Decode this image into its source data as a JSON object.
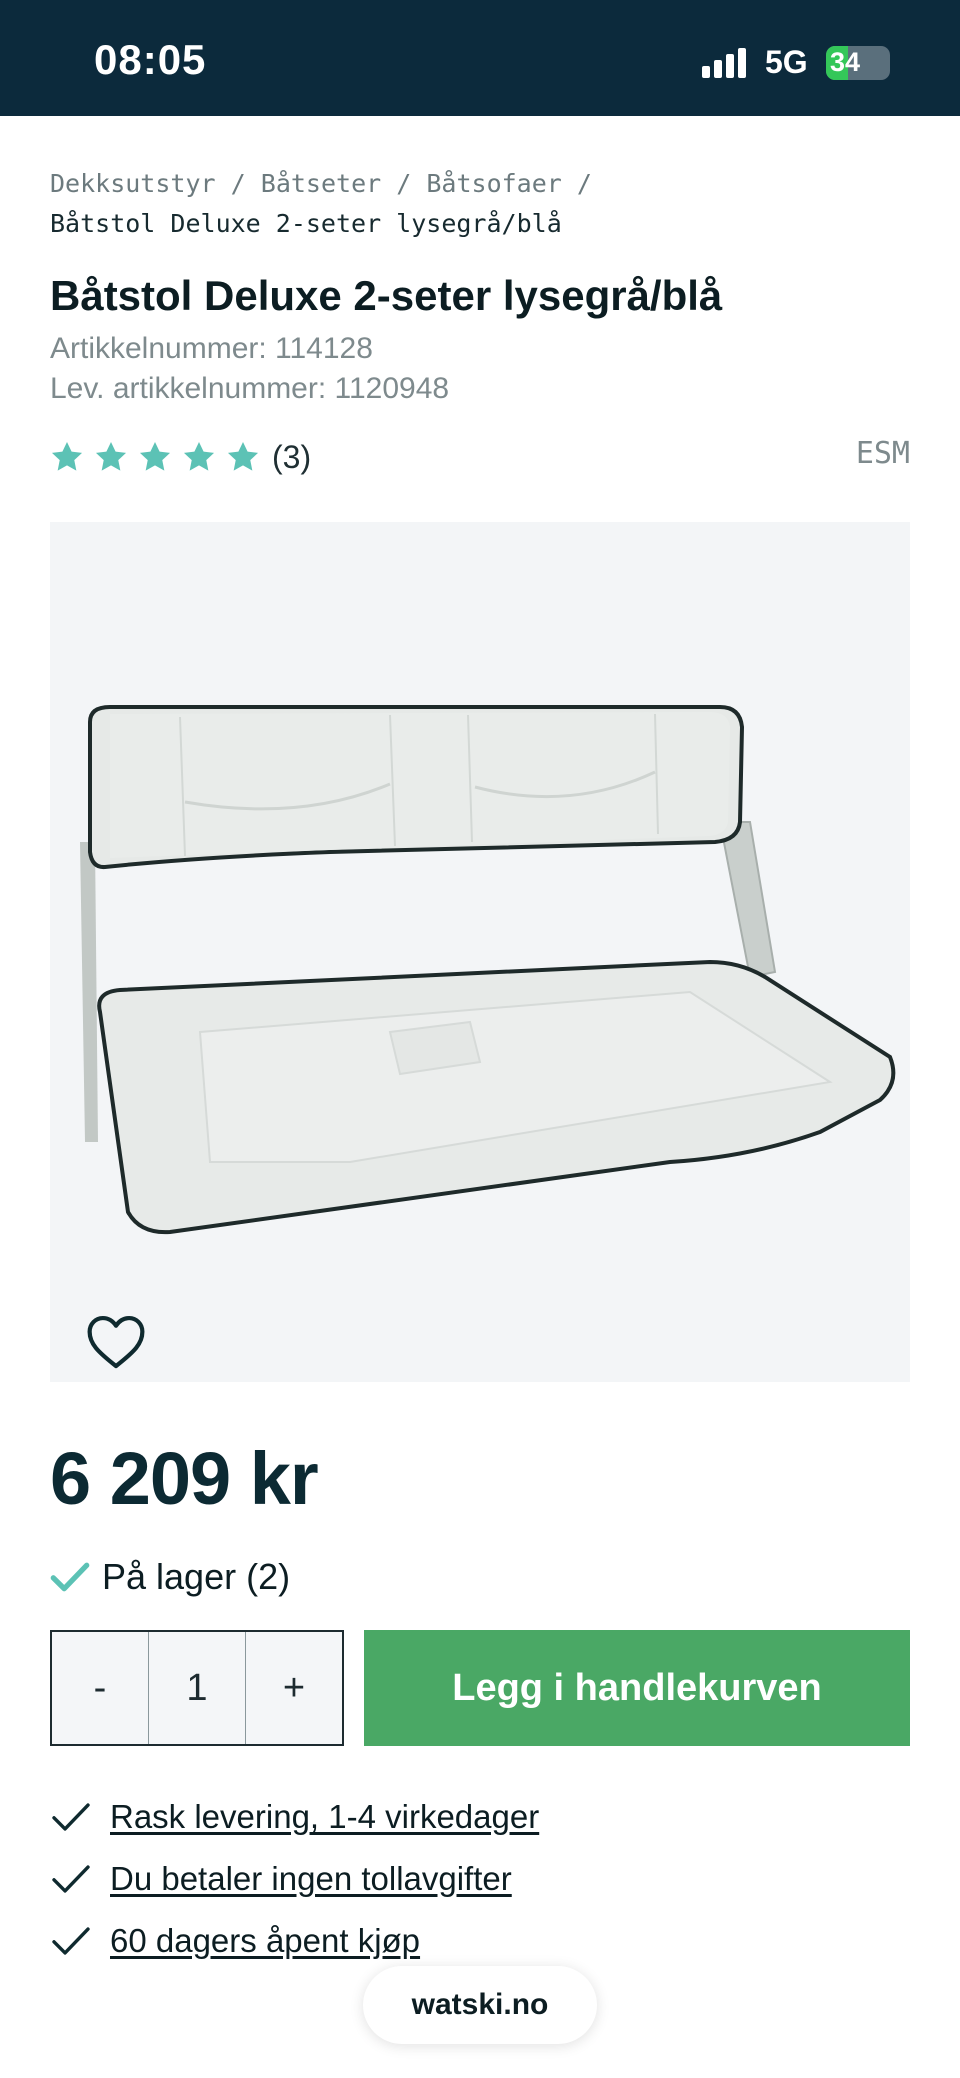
{
  "status_bar": {
    "time": "08:05",
    "network": "5G",
    "battery": "34",
    "battery_level_percent": 34,
    "signal_bars": 4
  },
  "breadcrumb": {
    "items": [
      "Dekksutstyr",
      "Båtseter",
      "Båtsofaer"
    ],
    "separator": "/",
    "current": "Båtstol Deluxe 2-seter lysegrå/blå"
  },
  "product": {
    "title": "Båtstol Deluxe 2-seter lysegrå/blå",
    "article_number": "Artikkelnummer: 114128",
    "supplier_article_number": "Lev. artikkelnummer: 1120948",
    "rating_stars": 5,
    "rating_count": "(3)",
    "brand": "ESM",
    "price": "6 209 kr",
    "stock": "På lager (2)",
    "quantity": "1"
  },
  "quantity_controls": {
    "decrement": "-",
    "increment": "+"
  },
  "add_to_cart_label": "Legg i handlekurven",
  "benefits": [
    "Rask levering, 1-4 virkedager",
    "Du betaler ingen tollavgifter",
    "60 dagers åpent kjøp"
  ],
  "browser": {
    "domain": "watski.no"
  },
  "colors": {
    "status_bar_bg": "#0c2a3c",
    "star": "#5cc2b5",
    "check_stock": "#5cc2b5",
    "cart_button": "#4aa865",
    "price_text": "#0c2a33",
    "image_bg": "#f3f5f7"
  },
  "icons": {
    "favorite": "heart-outline-icon",
    "check": "check-icon",
    "star": "star-icon"
  }
}
